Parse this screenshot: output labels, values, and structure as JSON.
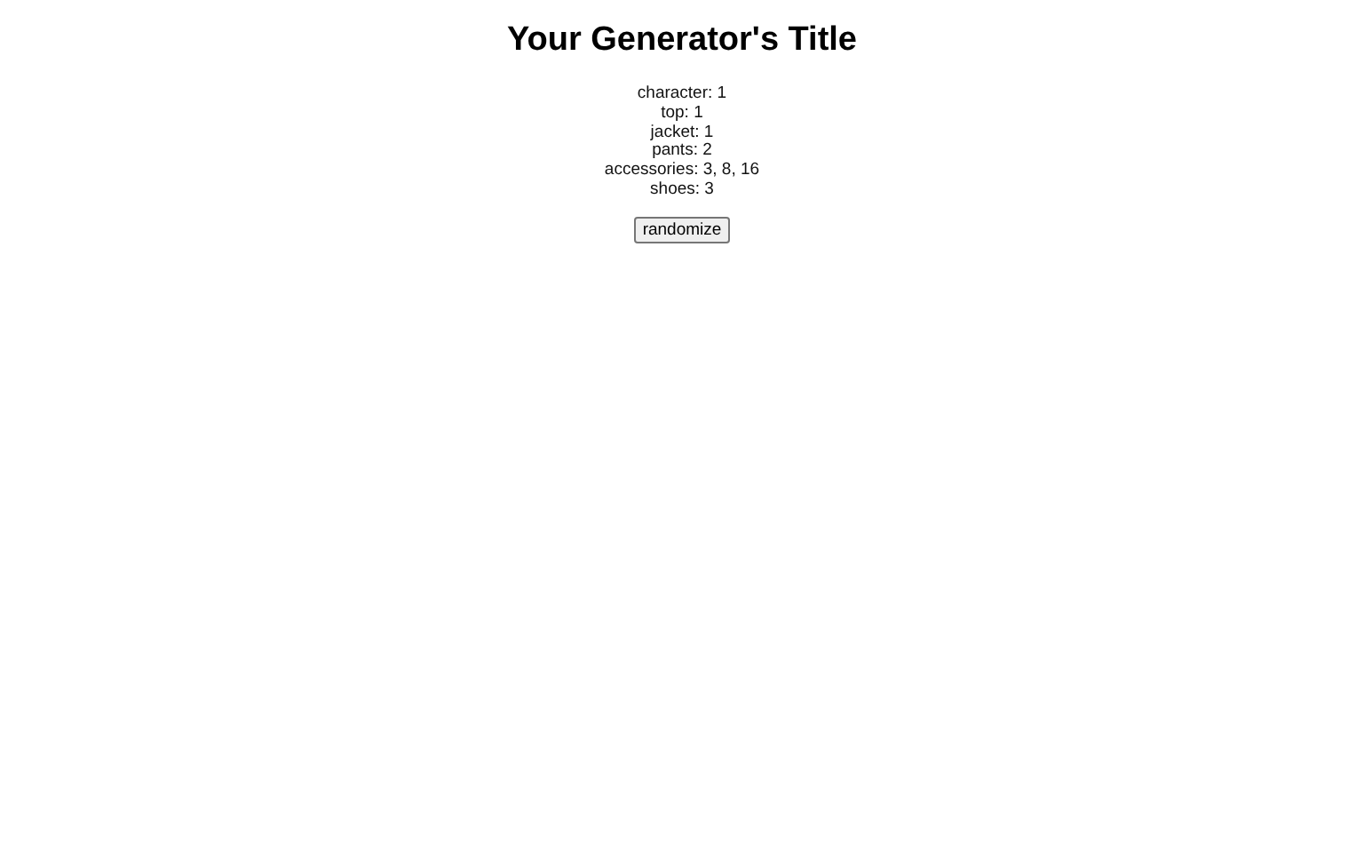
{
  "title": "Your Generator's Title",
  "results": [
    {
      "label": "character:",
      "value": "1"
    },
    {
      "label": "top:",
      "value": "1"
    },
    {
      "label": "jacket:",
      "value": "1"
    },
    {
      "label": "pants:",
      "value": "2"
    },
    {
      "label": "accessories:",
      "value": "3, 8, 16"
    },
    {
      "label": "shoes:",
      "value": "3"
    }
  ],
  "button": "randomize"
}
